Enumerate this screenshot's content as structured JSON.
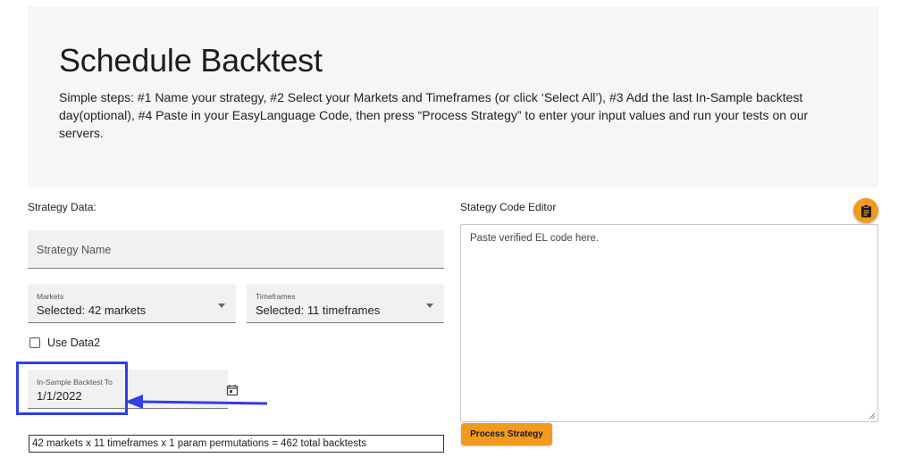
{
  "header": {
    "title": "Schedule Backtest",
    "description": "Simple steps: #1 Name your strategy, #2 Select your Markets and Timeframes (or click ‘Select All’), #3 Add the last In-Sample backtest day(optional), #4 Paste in your EasyLanguage Code, then press “Process Strategy” to enter your input values and run your tests on our servers."
  },
  "strategy_data": {
    "section_label": "Strategy Data:",
    "name_placeholder": "Strategy Name",
    "markets": {
      "label": "Markets",
      "value": "Selected: 42 markets"
    },
    "timeframes": {
      "label": "Timeframes",
      "value": "Selected: 11 timeframes"
    },
    "use_data2": {
      "label": "Use Data2",
      "checked": false
    },
    "in_sample": {
      "label": "In-Sample Backtest To",
      "value": "1/1/2022"
    },
    "summary": "42 markets x 11 timeframes x 1 param permutations = 462 total backtests"
  },
  "editor": {
    "section_label": "Stategy Code Editor",
    "placeholder": "Paste verified EL code here.",
    "process_button": "Process Strategy"
  },
  "colors": {
    "accent": "#f29a1f",
    "annotation": "#2f3fe6",
    "hero_background": "#f5f6f7"
  },
  "icons": {
    "paste": "clipboard-icon",
    "date": "calendar-icon",
    "dropdown": "chevron-down-icon"
  }
}
